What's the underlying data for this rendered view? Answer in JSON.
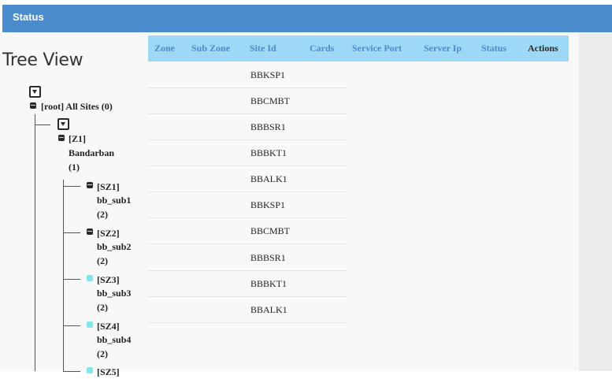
{
  "header": {
    "title": "Status"
  },
  "tree": {
    "title": "Tree View",
    "root": {
      "label": "[root] All Sites (0)"
    },
    "zone": {
      "label_line1": "[Z1]",
      "label_line2": "Bandarban",
      "label_line3": "(1)"
    },
    "subzones": [
      {
        "code": "[SZ1]",
        "name": "bb_sub1",
        "count": "(2)",
        "state": "expanded"
      },
      {
        "code": "[SZ2]",
        "name": "bb_sub2",
        "count": "(2)",
        "state": "expanded"
      },
      {
        "code": "[SZ3]",
        "name": "bb_sub3",
        "count": "(2)",
        "state": "leaf"
      },
      {
        "code": "[SZ4]",
        "name": "bb_sub4",
        "count": "(2)",
        "state": "leaf"
      },
      {
        "code": "[SZ5]",
        "state": "leaf"
      }
    ]
  },
  "table": {
    "columns": [
      "Zone",
      "Sub Zone",
      "Site Id",
      "Cards",
      "Service Port",
      "Server Ip",
      "Status",
      "Actions"
    ],
    "rows": [
      {
        "site_id": "BBKSP1"
      },
      {
        "site_id": "BBCMBT"
      },
      {
        "site_id": "BBBSR1"
      },
      {
        "site_id": "BBBKT1"
      },
      {
        "site_id": "BBALK1"
      },
      {
        "site_id": "BBKSP1"
      },
      {
        "site_id": "BBCMBT"
      },
      {
        "site_id": "BBBSR1"
      },
      {
        "site_id": "BBBKT1"
      },
      {
        "site_id": "BBALK1"
      }
    ]
  },
  "colors": {
    "header_bg": "#4a8ccc",
    "table_header_bg": "#9dd9f7",
    "table_header_text": "#4a8cc8",
    "leaf_icon": "#7ee8ee",
    "collapse_icon": "#2a2a2a"
  }
}
